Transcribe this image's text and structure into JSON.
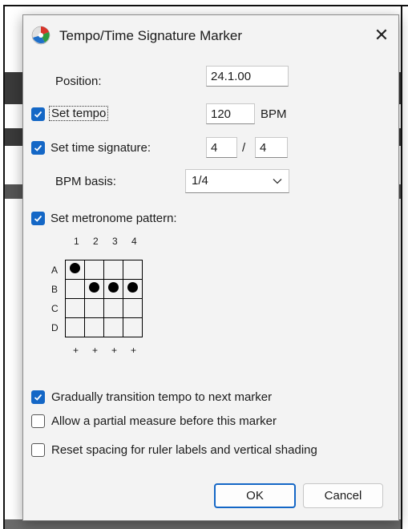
{
  "dialog": {
    "title": "Tempo/Time Signature Marker",
    "close_icon": "close-icon",
    "app_icon": "reaper-logo-icon"
  },
  "position": {
    "label": "Position:",
    "value": "24.1.00"
  },
  "tempo": {
    "label": "Set tempo",
    "checked": true,
    "value": "120",
    "unit": "BPM"
  },
  "time_signature": {
    "label": "Set time signature:",
    "checked": true,
    "numerator": "4",
    "separator": "/",
    "denominator": "4"
  },
  "bpm_basis": {
    "label": "BPM basis:",
    "value": "1/4",
    "icon": "chevron-down-icon"
  },
  "metronome": {
    "label": "Set metronome pattern:",
    "checked": true,
    "column_labels": [
      "1",
      "2",
      "3",
      "4"
    ],
    "row_labels": [
      "A",
      "B",
      "C",
      "D"
    ],
    "footer_labels": [
      "+",
      "+",
      "+",
      "+"
    ],
    "pattern": [
      [
        true,
        false,
        false,
        false
      ],
      [
        false,
        true,
        true,
        true
      ],
      [
        false,
        false,
        false,
        false
      ],
      [
        false,
        false,
        false,
        false
      ]
    ]
  },
  "options": [
    {
      "label": "Gradually transition tempo to next marker",
      "checked": true
    },
    {
      "label": "Allow a partial measure before this marker",
      "checked": false
    },
    {
      "label": "Reset spacing for ruler labels and vertical shading",
      "checked": false
    }
  ],
  "buttons": {
    "ok": "OK",
    "cancel": "Cancel"
  },
  "colors": {
    "accent": "#1467c6",
    "dialog_bg": "#f3f3f3",
    "background_track": "#3a3a3a"
  }
}
